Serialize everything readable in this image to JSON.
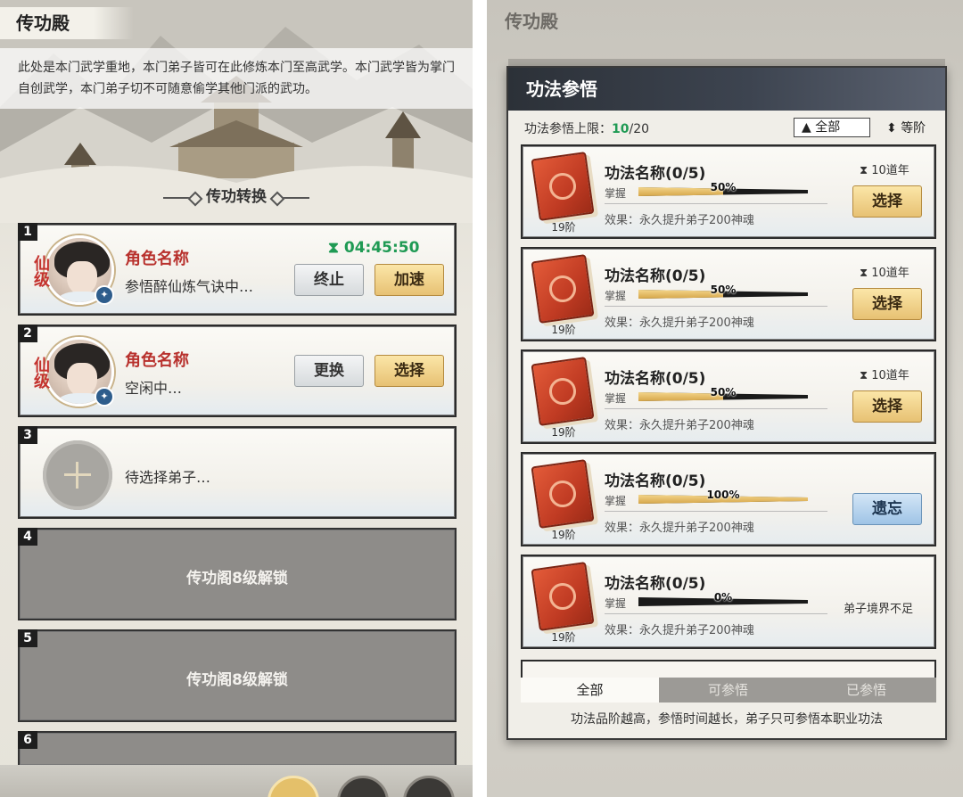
{
  "left": {
    "title": "传功殿",
    "intro": "此处是本门武学重地，本门弟子皆可在此修炼本门至高武学。本门武学皆为掌门自创武学，本门弟子切不可随意偷学其他门派的武功。",
    "section_title": "传功转换",
    "slots": [
      {
        "num": "1",
        "name": "角色名称",
        "xian": "仙级",
        "status": "参悟醉仙炼气诀中…",
        "timer": "04:45:50",
        "btn1": "终止",
        "btn2": "加速"
      },
      {
        "num": "2",
        "name": "角色名称",
        "xian": "仙级",
        "status": "空闲中…",
        "btn1": "更换",
        "btn2": "选择"
      },
      {
        "num": "3",
        "status": "待选择弟子…"
      },
      {
        "num": "4",
        "locked_text": "传功阁8级解锁"
      },
      {
        "num": "5",
        "locked_text": "传功阁8级解锁"
      },
      {
        "num": "6"
      }
    ]
  },
  "right": {
    "bg_title": "传功殿",
    "modal_title": "功法参悟",
    "limit_label": "功法参悟上限：",
    "limit_current": "10",
    "limit_max": "/20",
    "filter_label": "▲ 全部",
    "sort_label": "等阶",
    "skills": [
      {
        "name": "功法名称(0/5)",
        "mastery": "掌握",
        "progress": 0.5,
        "pct": "50%",
        "effect": "效果：永久提升弟子200神魂",
        "tier": "19阶",
        "years": "10道年",
        "action": "选择",
        "action_style": "gold"
      },
      {
        "name": "功法名称(0/5)",
        "mastery": "掌握",
        "progress": 0.5,
        "pct": "50%",
        "effect": "效果：永久提升弟子200神魂",
        "tier": "19阶",
        "years": "10道年",
        "action": "选择",
        "action_style": "gold"
      },
      {
        "name": "功法名称(0/5)",
        "mastery": "掌握",
        "progress": 0.5,
        "pct": "50%",
        "effect": "效果：永久提升弟子200神魂",
        "tier": "19阶",
        "years": "10道年",
        "action": "选择",
        "action_style": "gold"
      },
      {
        "name": "功法名称(0/5)",
        "mastery": "掌握",
        "progress": 1.0,
        "pct": "100%",
        "effect": "效果：永久提升弟子200神魂",
        "tier": "19阶",
        "action": "遗忘",
        "action_style": "blue"
      },
      {
        "name": "功法名称(0/5)",
        "mastery": "掌握",
        "progress": 0.0,
        "pct": "0%",
        "effect": "效果：永久提升弟子200神魂",
        "tier": "19阶",
        "note": "弟子境界不足"
      }
    ],
    "tabs": [
      "全部",
      "可参悟",
      "已参悟"
    ],
    "footer": "功法品阶越高，参悟时间越长，弟子只可参悟本职业功法"
  }
}
